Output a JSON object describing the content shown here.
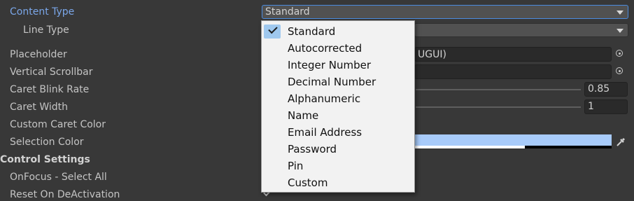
{
  "inspector": {
    "content_type": {
      "label": "Content Type",
      "value": "Standard"
    },
    "line_type": {
      "label": "Line Type",
      "value": ""
    },
    "placeholder": {
      "label": "Placeholder",
      "value_visible": "UGUI)"
    },
    "vertical_scrollbar": {
      "label": "Vertical Scrollbar",
      "value": ""
    },
    "caret_blink_rate": {
      "label": "Caret Blink Rate",
      "value": "0.85"
    },
    "caret_width": {
      "label": "Caret Width",
      "value": "1"
    },
    "custom_caret_color": {
      "label": "Custom Caret Color"
    },
    "selection_color": {
      "label": "Selection Color",
      "color": "#a8cbfa"
    },
    "control_settings": {
      "label": "Control Settings"
    },
    "onfocus_select_all": {
      "label": "OnFocus - Select All"
    },
    "reset_on_deactivation": {
      "label": "Reset On DeActivation"
    }
  },
  "content_type_menu": {
    "selected": "Standard",
    "items": [
      "Standard",
      "Autocorrected",
      "Integer Number",
      "Decimal Number",
      "Alphanumeric",
      "Name",
      "Email Address",
      "Password",
      "Pin",
      "Custom"
    ]
  },
  "icons": {
    "dropdown": "chevron-down-icon",
    "object_picker": "object-picker-icon",
    "eyedropper": "eyedropper-icon",
    "check": "check-icon"
  },
  "colors": {
    "background": "#383838",
    "label_active": "#7aa6e8",
    "menu_background": "#f2f2f2",
    "menu_check_highlight": "#9fc8ee"
  }
}
